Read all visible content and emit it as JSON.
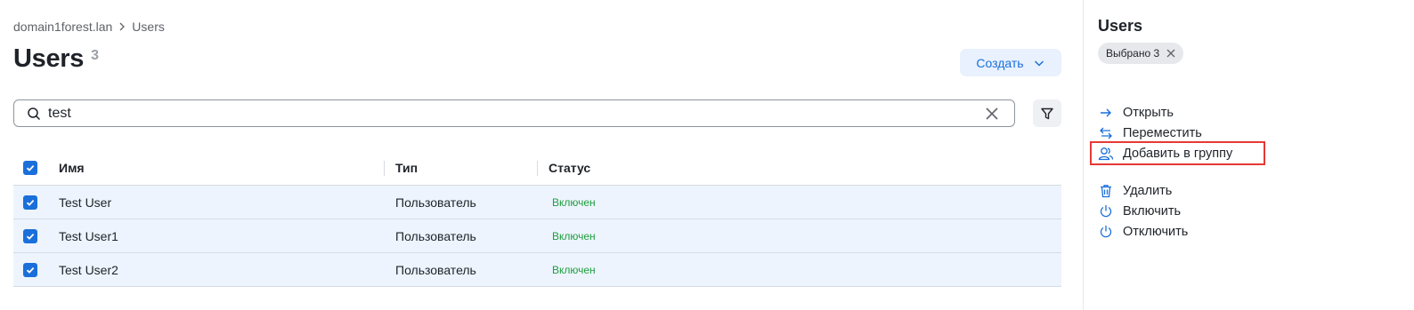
{
  "breadcrumb": {
    "root": "domain1forest.lan",
    "current": "Users"
  },
  "page": {
    "title": "Users",
    "count": "3"
  },
  "toolbar": {
    "create_label": "Создать"
  },
  "search": {
    "value": "test",
    "placeholder": ""
  },
  "table": {
    "headers": {
      "name": "Имя",
      "type": "Тип",
      "status": "Статус"
    },
    "rows": [
      {
        "name": "Test User",
        "type": "Пользователь",
        "status": "Включен",
        "checked": true
      },
      {
        "name": "Test User1",
        "type": "Пользователь",
        "status": "Включен",
        "checked": true
      },
      {
        "name": "Test User2",
        "type": "Пользователь",
        "status": "Включен",
        "checked": true
      }
    ]
  },
  "sidebar": {
    "title": "Users",
    "selected_chip": "Выбрано 3",
    "actions": [
      {
        "label": "Открыть",
        "icon": "arrow-right-icon"
      },
      {
        "label": "Переместить",
        "icon": "swap-arrows-icon"
      },
      {
        "label": "Добавить в группу",
        "icon": "users-icon"
      },
      {
        "label": "Удалить",
        "icon": "trash-icon"
      },
      {
        "label": "Включить",
        "icon": "power-icon"
      },
      {
        "label": "Отключить",
        "icon": "power-icon"
      }
    ]
  },
  "colors": {
    "accent": "#1a6fdb",
    "status_enabled": "#1e9e3f",
    "highlight": "#e53935",
    "selected_row": "#edf4fd"
  }
}
